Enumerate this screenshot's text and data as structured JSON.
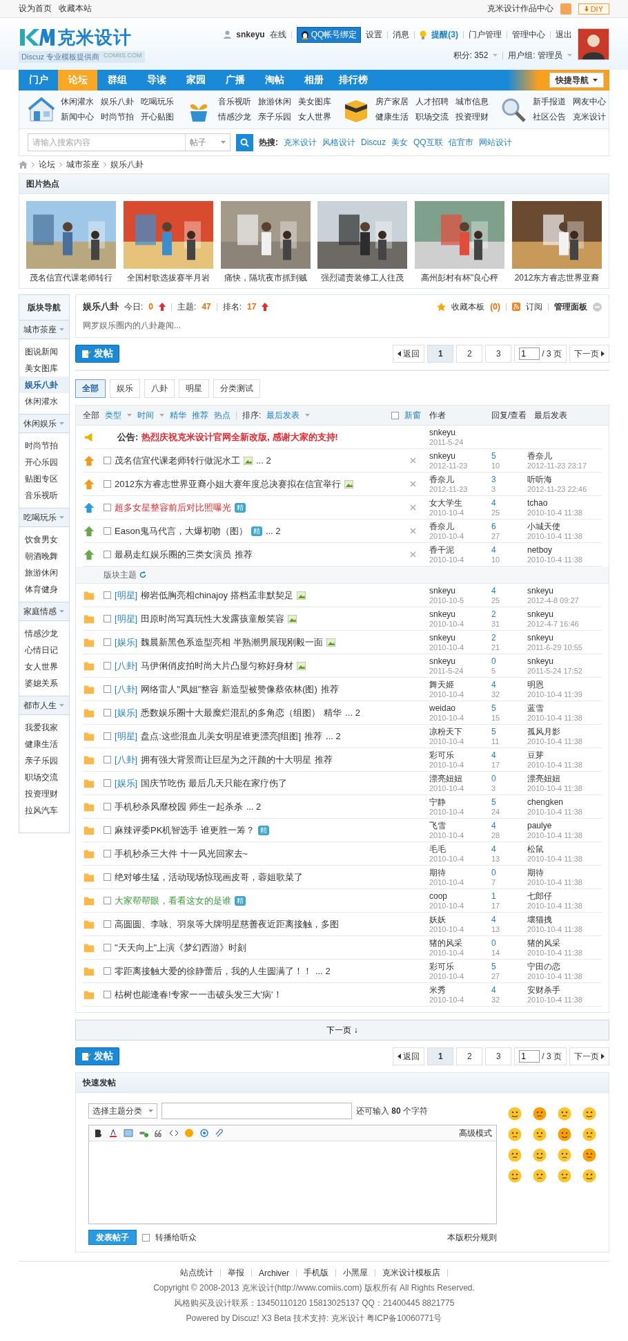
{
  "top_bar": {
    "links": [
      "设为首页",
      "收藏本站"
    ],
    "right_link": "克米设计作品中心",
    "diy_button": "DIY"
  },
  "header": {
    "logo_text": "克米设计",
    "tagline": "Discuz 专业模板提供商",
    "domain": "COMIIS.COM"
  },
  "user": {
    "name": "snkeyu",
    "status": "在线",
    "qq_button": "QQ帐号绑定",
    "links": [
      "设置",
      "消息"
    ],
    "reminder": "提醒(3)",
    "links_after": [
      "门户管理",
      "管理中心",
      "退出"
    ],
    "points": "积分: 352",
    "group": "用户组: 管理员"
  },
  "nav": {
    "items": [
      {
        "label": "门户",
        "selected": false
      },
      {
        "label": "论坛",
        "selected": true
      },
      {
        "label": "群组",
        "selected": false
      },
      {
        "label": "导读",
        "selected": false
      },
      {
        "label": "家园",
        "selected": false
      },
      {
        "label": "广播",
        "selected": false
      },
      {
        "label": "淘帖",
        "selected": false
      },
      {
        "label": "相册",
        "selected": false
      },
      {
        "label": "排行榜",
        "selected": false
      }
    ],
    "quick_nav": "快捷导航"
  },
  "category_groups": [
    {
      "kind": "house",
      "links": [
        "休闲灌水",
        "娱乐八卦",
        "吃喝玩乐",
        "新闻中心",
        "时尚节拍",
        "开心贴图"
      ]
    },
    {
      "kind": "plant",
      "links": [
        "音乐视听",
        "旅游休闲",
        "美女图库",
        "情感沙龙",
        "亲子乐园",
        "女人世界"
      ]
    },
    {
      "kind": "box",
      "links": [
        "房产家居",
        "人才招聘",
        "城市信息",
        "健康生活",
        "职场交流",
        "投资理财"
      ]
    },
    {
      "kind": "magnifier",
      "links": [
        "新手报道",
        "网友中心",
        "社区公告",
        "克米设计"
      ]
    }
  ],
  "search": {
    "placeholder": "请输入搜索内容",
    "scope": "帖子",
    "hot_label": "热搜:",
    "hot": [
      "克米设计",
      "风格设计",
      "Discuz",
      "美女",
      "QQ互联",
      "信宜市",
      "网站设计"
    ]
  },
  "breadcrumb": [
    "论坛",
    "城市茶座",
    "娱乐八卦"
  ],
  "picture_hot": {
    "title": "图片热点",
    "items": [
      {
        "caption": "茂名信宜代课老师转行"
      },
      {
        "caption": "全国村歌选拔赛半月岩"
      },
      {
        "caption": "痛快，隔坑夜市抓到贼"
      },
      {
        "caption": "强烈谴责装修工人往茂"
      },
      {
        "caption": "高州彭村有杯\"良心秤"
      },
      {
        "caption": "2012东方睿志世界亚裔"
      }
    ]
  },
  "sidebar": {
    "title": "版块导航",
    "groups": [
      {
        "name": "城市茶座",
        "items": [
          {
            "label": "图说新闻",
            "selected": false
          },
          {
            "label": "美女图库",
            "selected": false
          },
          {
            "label": "娱乐八卦",
            "selected": true
          },
          {
            "label": "休闲灌水",
            "selected": false
          }
        ]
      },
      {
        "name": "休闲娱乐",
        "items": [
          {
            "label": "时尚节拍",
            "selected": false
          },
          {
            "label": "开心乐园",
            "selected": false
          },
          {
            "label": "贴图专区",
            "selected": false
          },
          {
            "label": "音乐视听",
            "selected": false
          }
        ]
      },
      {
        "name": "吃喝玩乐",
        "items": [
          {
            "label": "饮食男女",
            "selected": false
          },
          {
            "label": "朝酒晚舞",
            "selected": false
          },
          {
            "label": "旅游休闲",
            "selected": false
          },
          {
            "label": "体育健身",
            "selected": false
          }
        ]
      },
      {
        "name": "家庭情感",
        "items": [
          {
            "label": "情感沙龙",
            "selected": false
          },
          {
            "label": "心情日记",
            "selected": false
          },
          {
            "label": "女人世界",
            "selected": false
          },
          {
            "label": "婆媳关系",
            "selected": false
          }
        ]
      },
      {
        "name": "都市人生",
        "items": [
          {
            "label": "我爱我家",
            "selected": false
          },
          {
            "label": "健康生活",
            "selected": false
          },
          {
            "label": "亲子乐园",
            "selected": false
          },
          {
            "label": "职场交流",
            "selected": false
          },
          {
            "label": "投资理财",
            "selected": false
          },
          {
            "label": "拉风汽车",
            "selected": false
          }
        ]
      }
    ]
  },
  "forum": {
    "name": "娱乐八卦",
    "today_label": "今日:",
    "today": "0",
    "topics_label": "主题:",
    "topics": "47",
    "rank_label": "排名:",
    "rank": "17",
    "favorite": "收藏本板",
    "favorite_count": "(0)",
    "subscribe": "订阅",
    "manage": "管理面板",
    "description": "网罗娱乐圈内的八卦趣闻..."
  },
  "pager_top": {
    "post_button": "发帖",
    "back": "返回",
    "pages": [
      {
        "label": "1",
        "selected": true
      },
      {
        "label": "2",
        "selected": false
      },
      {
        "label": "3",
        "selected": false
      }
    ],
    "page_input": "1",
    "total": "/ 3 页",
    "next": "下一页"
  },
  "filter_tabs": [
    {
      "label": "全部",
      "selected": true
    },
    {
      "label": "娱乐",
      "selected": false
    },
    {
      "label": "八卦",
      "selected": false
    },
    {
      "label": "明星",
      "selected": false
    },
    {
      "label": "分类测试",
      "selected": false
    }
  ],
  "thread_table": {
    "filters": [
      {
        "label": "全部",
        "dropdown": false
      },
      {
        "label": "类型",
        "dropdown": true
      },
      {
        "label": "时间",
        "dropdown": true
      },
      {
        "label": "精华",
        "dropdown": false
      },
      {
        "label": "推荐",
        "dropdown": false
      },
      {
        "label": "热点",
        "dropdown": false
      }
    ],
    "sort_label": "排序:",
    "sort_value": "最后发表",
    "new_window": {
      "label": "新窗",
      "checked": false
    },
    "columns": [
      "作者",
      "回复/查看",
      "最后发表"
    ],
    "announcement": {
      "label": "公告:",
      "text": "热烈庆祝克米设计官网全新改版, 感谢大家的支持!",
      "author": "snkeyu",
      "date": "2011-5-24"
    },
    "sticky_threads": [
      {
        "kind": "top3",
        "checked": false,
        "title": "茂名信宜代课老师转行做泥水工",
        "attachment": true,
        "pages": "... 2",
        "closable": true,
        "author": "snkeyu",
        "date": "2012-11-23",
        "replies": "5",
        "views": "10",
        "last_user": "香奈儿",
        "last_time": "2012-11-23 23:17"
      },
      {
        "kind": "top3",
        "checked": false,
        "title": "2012东方睿志世界亚裔小姐大赛年度总决赛拟在信宜举行",
        "attachment": true,
        "closable": true,
        "author": "香奈儿",
        "date": "2012-11-23",
        "replies": "3",
        "views": "3",
        "last_user": "听听海",
        "last_time": "2012-11-23 22:46"
      },
      {
        "kind": "top2",
        "checked": false,
        "title": "超多女星整容前后对比照曝光",
        "color": "#e8292f",
        "digest": "精",
        "closable": true,
        "author": "女大学生",
        "date": "2010-10-4",
        "replies": "4",
        "views": "25",
        "last_user": "tchao",
        "last_time": "2010-10-4 11:38"
      },
      {
        "kind": "top1",
        "checked": false,
        "title": "Eason鬼马代言，大爆初吻（图）",
        "digest": "精",
        "pages": "... 2",
        "closable": true,
        "author": "香奈儿",
        "date": "2010-10-4",
        "replies": "6",
        "views": "27",
        "last_user": "小城天使",
        "last_time": "2010-10-4 11:38"
      },
      {
        "kind": "top1",
        "checked": false,
        "title": "最易走红娱乐圈的三类女演员",
        "suffix": "推荐",
        "closable": true,
        "author": "香干泥",
        "date": "2010-10-4",
        "replies": "4",
        "views": "10",
        "last_user": "netboy",
        "last_time": "2010-10-4 11:38"
      }
    ],
    "section_label": "版块主题",
    "threads": [
      {
        "kind": "folder",
        "checked": false,
        "tag": "[明星]",
        "title": "柳岩低胸亮相chinajoy 搭档孟非默契足",
        "attachment": true,
        "author": "snkeyu",
        "date": "2010-10-5",
        "replies": "4",
        "views": "25",
        "last_user": "snkeyu",
        "last_time": "2012-4-8 09:27"
      },
      {
        "kind": "folder",
        "checked": false,
        "tag": "[明星]",
        "title": "田原时尚写真玩性大发露孩童般笑容",
        "attachment": true,
        "author": "snkeyu",
        "date": "2010-10-4",
        "replies": "2",
        "views": "31",
        "last_user": "snkeyu",
        "last_time": "2012-4-7 16:46"
      },
      {
        "kind": "folder",
        "checked": false,
        "tag": "[娱乐]",
        "title": "魏晨新黑色系造型亮相 半熟潮男展现刚毅一面",
        "attachment": true,
        "author": "snkeyu",
        "date": "2010-10-4",
        "replies": "2",
        "views": "21",
        "last_user": "snkeyu",
        "last_time": "2011-6-29 10:55"
      },
      {
        "kind": "folder",
        "checked": false,
        "tag": "[八卦]",
        "title": "马伊俐俏皮拍时尚大片凸显匀称好身材",
        "attachment": true,
        "author": "snkeyu",
        "date": "2011-5-24",
        "replies": "0",
        "views": "5",
        "last_user": "snkeyu",
        "last_time": "2011-5-24 17:52"
      },
      {
        "kind": "folder",
        "checked": false,
        "tag": "[八卦]",
        "title": "网络雷人\"凤姐\"整容 新造型被赞像蔡依林(图)",
        "suffix": "推荐",
        "author": "舞天姬",
        "date": "2010-10-4",
        "replies": "4",
        "views": "32",
        "last_user": "明恩",
        "last_time": "2010-10-4 11:39"
      },
      {
        "kind": "folder",
        "checked": false,
        "tag": "[娱乐]",
        "title": "悉数娱乐圈十大最糜烂混乱的多角恋（组图）",
        "suffix": "精华",
        "pages": "... 2",
        "author": "weidao",
        "date": "2010-10-4",
        "replies": "5",
        "views": "15",
        "last_user": "蓝雪",
        "last_time": "2010-10-4 11:38"
      },
      {
        "kind": "folder",
        "checked": false,
        "tag": "[明星]",
        "title": "盘点:这些混血儿美女明星谁更漂亮[组图]",
        "suffix": "推荐",
        "pages": "... 2",
        "author": "凉粉天下",
        "date": "2010-10-4",
        "replies": "5",
        "views": "11",
        "last_user": "孤风月影",
        "last_time": "2010-10-4 11:38"
      },
      {
        "kind": "folder",
        "checked": false,
        "tag": "[八卦]",
        "title": "拥有强大背景而让巨星为之汗颜的十大明星",
        "suffix": "推荐",
        "author": "彩可乐",
        "date": "2010-10-4",
        "replies": "4",
        "views": "17",
        "last_user": "豆芽",
        "last_time": "2010-10-4 11:38"
      },
      {
        "kind": "folder",
        "checked": false,
        "tag": "[娱乐]",
        "title": "国庆节吃伤 最后几天只能在家疗伤了",
        "author": "漂亮妞妞",
        "date": "2010-10-4",
        "replies": "0",
        "views": "3",
        "last_user": "漂亮妞妞",
        "last_time": "2010-10-4 11:38"
      },
      {
        "kind": "folder",
        "checked": false,
        "title": "手机秒杀风靡校园 师生一起杀杀",
        "pages": "... 2",
        "author": "宁静",
        "date": "2010-10-4",
        "replies": "5",
        "views": "24",
        "last_user": "chengken",
        "last_time": "2010-10-4 11:38"
      },
      {
        "kind": "folder",
        "checked": false,
        "title": "麻辣评委PK机智选手 谁更胜一筹？",
        "digest": "精",
        "author": "飞雪",
        "date": "2010-10-4",
        "replies": "4",
        "views": "28",
        "last_user": "paulye",
        "last_time": "2010-10-4 11:38"
      },
      {
        "kind": "folder",
        "checked": false,
        "title": "手机秒杀三大件 十一风光回家去~",
        "author": "毛毛",
        "date": "2010-10-4",
        "replies": "4",
        "views": "13",
        "last_user": "松鼠",
        "last_time": "2010-10-4 11:38"
      },
      {
        "kind": "folder",
        "checked": false,
        "title": "绝对够生猛，活动现场惊现画皮哥，蓉姐歌菜了",
        "author": "期待",
        "date": "2010-10-4",
        "replies": "0",
        "views": "7",
        "last_user": "期待",
        "last_time": "2010-10-4 11:38"
      },
      {
        "kind": "folder",
        "checked": false,
        "title": "大家帮帮眼，看看这女的是谁",
        "color": "#3c9d3c",
        "digest": "精",
        "author": "coop",
        "date": "2010-10-4",
        "replies": "1",
        "views": "17",
        "last_user": "七郎仔",
        "last_time": "2010-10-4 11:38"
      },
      {
        "kind": "folder",
        "checked": false,
        "title": "高圆圆、李咏、羽泉等大牌明星慈善夜近距离接触，多图",
        "author": "妖妖",
        "date": "2010-10-4",
        "replies": "4",
        "views": "13",
        "last_user": "壞猫拽",
        "last_time": "2010-10-4 11:38"
      },
      {
        "kind": "folder",
        "checked": false,
        "title": "\"天天向上\"上演《梦幻西游》时刻",
        "author": "猪的风采",
        "date": "2010-10-4",
        "replies": "0",
        "views": "14",
        "last_user": "猪的风采",
        "last_time": "2010-10-4 11:38"
      },
      {
        "kind": "folder",
        "checked": false,
        "title": "零距离接触大爱的徐静蕾后，我的人生圆满了！！",
        "pages": "... 2",
        "author": "彩可乐",
        "date": "2010-10-4",
        "replies": "5",
        "views": "27",
        "last_user": "宁田の恋",
        "last_time": "2010-10-4 11:38"
      },
      {
        "kind": "folder",
        "checked": false,
        "title": "枯树也能逢春!专家一一击破头发三大'病'！",
        "author": "米秀",
        "date": "2010-10-4",
        "replies": "4",
        "views": "32",
        "last_user": "安财杀手",
        "last_time": "2010-10-4 11:38"
      }
    ]
  },
  "next_page_bar": "下一页 ↓",
  "pager_bottom": {
    "post_button": "发帖",
    "back": "返回",
    "pages": [
      {
        "label": "1",
        "selected": true
      },
      {
        "label": "2",
        "selected": false
      },
      {
        "label": "3",
        "selected": false
      }
    ],
    "page_input": "1",
    "total": "/ 3 页",
    "next": "下一页"
  },
  "quick_post": {
    "title": "快速发帖",
    "category_select": "选择主题分类",
    "remaining": "还可输入 **80** 个字符",
    "advanced_mode": "高级模式",
    "submit": "发表帖子",
    "broadcast": {
      "label": "转播给听众",
      "checked": false
    },
    "rules_link": "本版积分规则"
  },
  "footer": {
    "links": [
      "站点统计",
      "举报",
      "Archiver",
      "手机版",
      "小黑屋",
      "克米设计模板店"
    ],
    "lines": [
      "Copyright © 2008-2013 克米设计(http://www.comiis.com) 版权所有 All Rights Reserved.",
      "风格购买及设计联系：13450110120 15813025137 QQ：21400445 8821775",
      "Powered by Discuz! X3 Beta  技术支持: 克米设计 粤ICP备10060771号"
    ]
  }
}
